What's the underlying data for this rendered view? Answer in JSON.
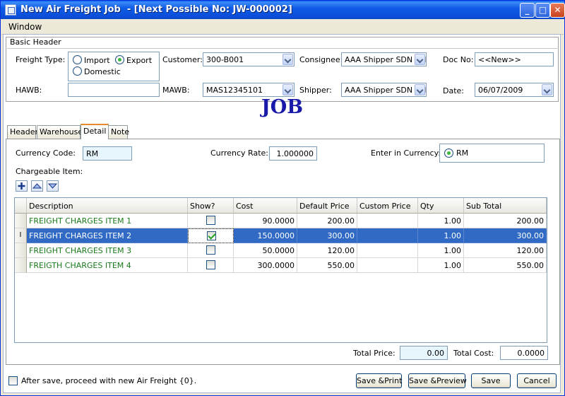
{
  "window": {
    "title": "New Air Freight Job  - [Next Possible No: JW-000002]"
  },
  "menu": {
    "window_label": "Window"
  },
  "basic_header": {
    "title": "Basic Header",
    "freight_type_label": "Freight Type:",
    "freight_options": {
      "import": "Import",
      "export": "Export",
      "domestic": "Domestic"
    },
    "freight_selected": "Export",
    "customer_label": "Customer:",
    "customer_value": "300-B001",
    "consignee_label": "Consignee:",
    "consignee_value": "AAA Shipper SDN BH",
    "doc_no_label": "Doc No:",
    "doc_no_value": "<<New>>",
    "hawb_label": "HAWB:",
    "hawb_value": "",
    "mawb_label": "MAWB:",
    "mawb_value": "MAS12345101",
    "shipper_label": "Shipper:",
    "shipper_value": "AAA Shipper SDN BH",
    "date_label": "Date:",
    "date_value": "06/07/2009"
  },
  "heading": "JOB",
  "tabs": [
    "Header",
    "Warehouse",
    "Detail",
    "Note"
  ],
  "active_tab": "Detail",
  "detail": {
    "currency_code_label": "Currency Code:",
    "currency_code_value": "RM",
    "currency_rate_label": "Currency Rate:",
    "currency_rate_value": "1.000000",
    "enter_in_currency_label": "Enter in Currency:",
    "enter_in_currency_value": "RM",
    "chargeable_item_label": "Chargeable Item:",
    "columns": [
      "Description",
      "Show?",
      "Cost",
      "Default Price",
      "Custom Price",
      "Qty",
      "Sub Total"
    ],
    "rows": [
      {
        "description": "FREIGHT CHARGES ITEM 1",
        "show": false,
        "cost": "90.0000",
        "default_price": "200.00",
        "custom_price": "",
        "qty": "1.00",
        "sub_total": "200.00"
      },
      {
        "description": "FREIGHT CHARGES ITEM 2",
        "show": true,
        "cost": "150.0000",
        "default_price": "300.00",
        "custom_price": "",
        "qty": "1.00",
        "sub_total": "300.00"
      },
      {
        "description": "FREIGHT CHARGES ITEM 3",
        "show": false,
        "cost": "50.0000",
        "default_price": "120.00",
        "custom_price": "",
        "qty": "1.00",
        "sub_total": "120.00"
      },
      {
        "description": "FREIGTH CHARGES ITEM 4",
        "show": false,
        "cost": "300.0000",
        "default_price": "550.00",
        "custom_price": "",
        "qty": "1.00",
        "sub_total": "550.00"
      }
    ],
    "selected_row_index": 1,
    "row_cursor_glyph": "I",
    "total_price_label": "Total Price:",
    "total_price_value": "0.00",
    "total_cost_label": "Total Cost:",
    "total_cost_value": "0.0000"
  },
  "footer": {
    "proceed_label": "After save, proceed with new Air Freight {0}.",
    "save_print": "Save &Print",
    "save_preview": "Save &Preview",
    "save": "Save",
    "cancel": "Cancel"
  },
  "colors": {
    "title_bar": "#0b4ed8",
    "selection": "#316ac5",
    "description_text": "#1a7a1a",
    "heading": "#1a1aaa"
  }
}
